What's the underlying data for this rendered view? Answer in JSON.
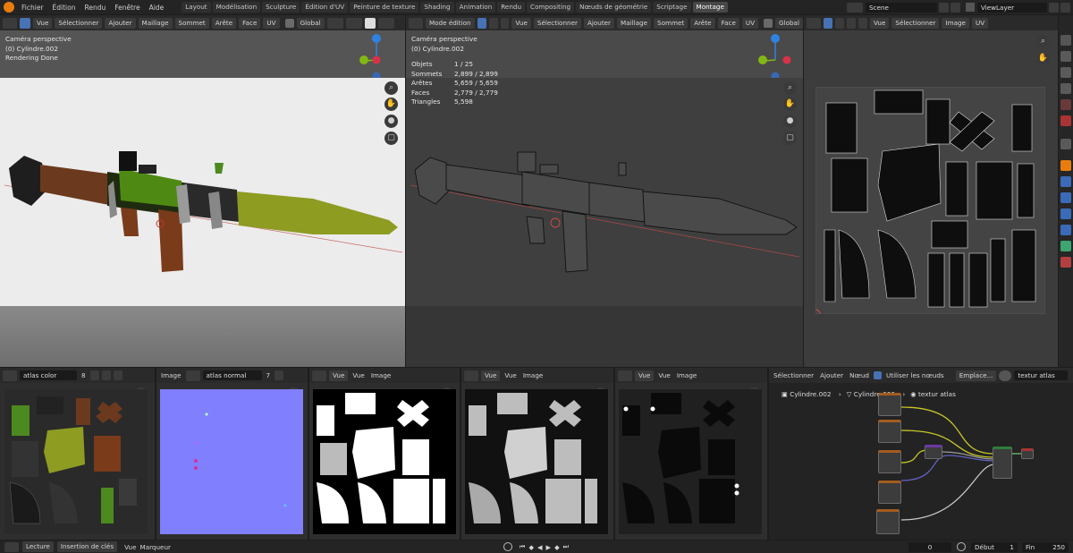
{
  "app": {
    "menus": [
      "Fichier",
      "Édition",
      "Rendu",
      "Fenêtre",
      "Aide"
    ],
    "workspaces": [
      "Layout",
      "Modélisation",
      "Sculpture",
      "Édition d'UV",
      "Peinture de texture",
      "Shading",
      "Animation",
      "Rendu",
      "Compositing",
      "Nœuds de géométrie",
      "Scriptage",
      "Montage"
    ],
    "active_workspace": "Montage",
    "scene": "Scene",
    "view_layer": "ViewLayer"
  },
  "viewport_left": {
    "menus": [
      "Vue",
      "Sélectionner",
      "Ajouter",
      "Maillage",
      "Sommet",
      "Arête",
      "Face",
      "UV"
    ],
    "orientation": "Global",
    "camera": "Caméra perspective",
    "object": "(0) Cylindre.002",
    "status": "Rendering Done"
  },
  "viewport_mid": {
    "mode": "Mode édition",
    "menus": [
      "Vue",
      "Sélectionner",
      "Ajouter",
      "Maillage",
      "Sommet",
      "Arête",
      "Face",
      "UV"
    ],
    "orientation": "Global",
    "camera": "Caméra perspective",
    "object": "(0) Cylindre.002",
    "stats": [
      {
        "label": "Objets",
        "value": "1 / 25"
      },
      {
        "label": "Sommets",
        "value": "2,899 / 2,899"
      },
      {
        "label": "Arêtes",
        "value": "5,659 / 5,659"
      },
      {
        "label": "Faces",
        "value": "2,779 / 2,779"
      },
      {
        "label": "Triangles",
        "value": "5,598"
      }
    ]
  },
  "uv_editor": {
    "menus": [
      "Vue",
      "Sélectionner",
      "Image",
      "UV"
    ]
  },
  "img_editors": [
    {
      "image": "atlas color",
      "users": "8"
    },
    {
      "label": "Image",
      "image": "atlas normal",
      "users": "7"
    },
    {
      "menus": [
        "Vue",
        "Vue",
        "Image"
      ]
    },
    {
      "menus": [
        "Vue",
        "Vue",
        "Image"
      ]
    },
    {
      "menus": [
        "Vue",
        "Vue",
        "Image"
      ]
    }
  ],
  "node_editor": {
    "menus": [
      "Sélectionner",
      "Ajouter",
      "Nœud"
    ],
    "use_nodes": "Utiliser les nœuds",
    "slot": "Emplace...",
    "material": "textur atlas",
    "breadcrumb": [
      "Cylindre.002",
      "Cylindre.003",
      "textur atlas"
    ]
  },
  "timeline": {
    "mode": "Lecture",
    "keying": "Insertion de clés",
    "menus": [
      "Vue",
      "Marqueur"
    ],
    "current_frame": "0",
    "start_label": "Début",
    "start": "1",
    "end_label": "Fin",
    "end": "250"
  },
  "colors": {
    "accent": "#4772b3",
    "normal_map": "#8080ff",
    "olive": "#8e9c22",
    "wood": "#6b3a1e"
  }
}
